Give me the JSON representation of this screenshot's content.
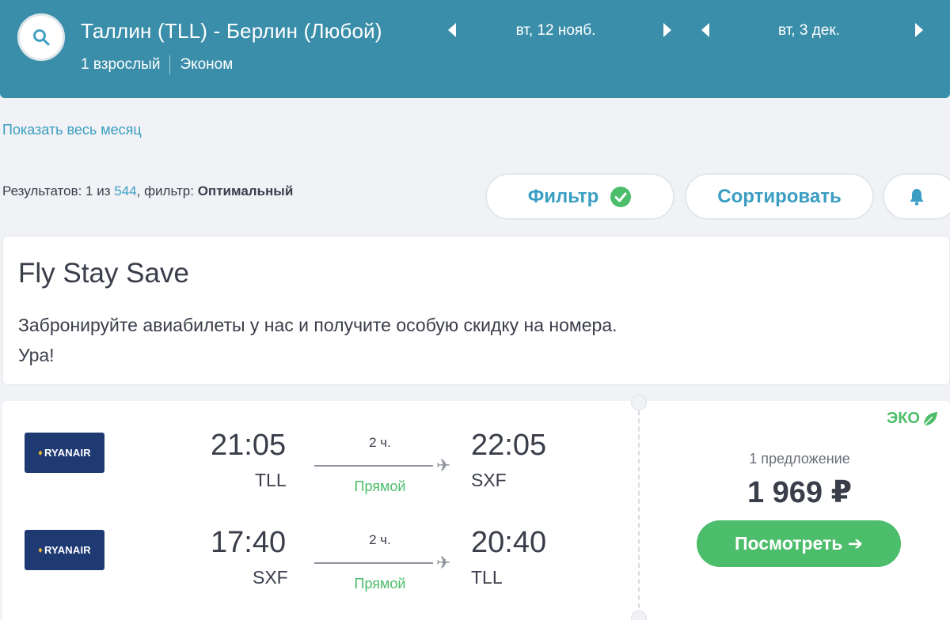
{
  "header": {
    "route": "Таллин (TLL) - Берлин (Любой)",
    "passengers": "1 взрослый",
    "cabin": "Эконом",
    "depart_date": "вт, 12 нояб.",
    "return_date": "вт, 3 дек."
  },
  "month_link": "Показать весь месяц",
  "results": {
    "prefix": "Результатов: 1 из ",
    "total": "544",
    "filter_prefix": ", фильтр: ",
    "filter_value": "Оптимальный"
  },
  "toolbar": {
    "filter_label": "Фильтр",
    "sort_label": "Сортировать"
  },
  "promo": {
    "title": "Fly Stay Save",
    "text": "Забронируйте авиабилеты у нас и получите особую скидку на номера. Ура!"
  },
  "ticket": {
    "eco_label": "ЭКО",
    "offers": "1 предложение",
    "price": "1 969 ₽",
    "view_label": "Посмотреть ➔",
    "legs": [
      {
        "airline": "RYANAIR",
        "dep_time": "21:05",
        "dep_code": "TLL",
        "duration": "2 ч.",
        "stops": "Прямой",
        "arr_time": "22:05",
        "arr_code": "SXF"
      },
      {
        "airline": "RYANAIR",
        "dep_time": "17:40",
        "dep_code": "SXF",
        "duration": "2 ч.",
        "stops": "Прямой",
        "arr_time": "20:40",
        "arr_code": "TLL"
      }
    ]
  },
  "colors": {
    "header_bg": "#3a8eaa",
    "accent_blue": "#3a9ec2",
    "accent_green": "#4cbd6a",
    "airline_navy": "#1f3a73"
  },
  "icons": [
    "search-icon",
    "chevron-left-icon",
    "chevron-right-icon",
    "check-circle-icon",
    "bell-icon",
    "plane-icon",
    "leaf-icon",
    "ryanair-harp-icon"
  ]
}
